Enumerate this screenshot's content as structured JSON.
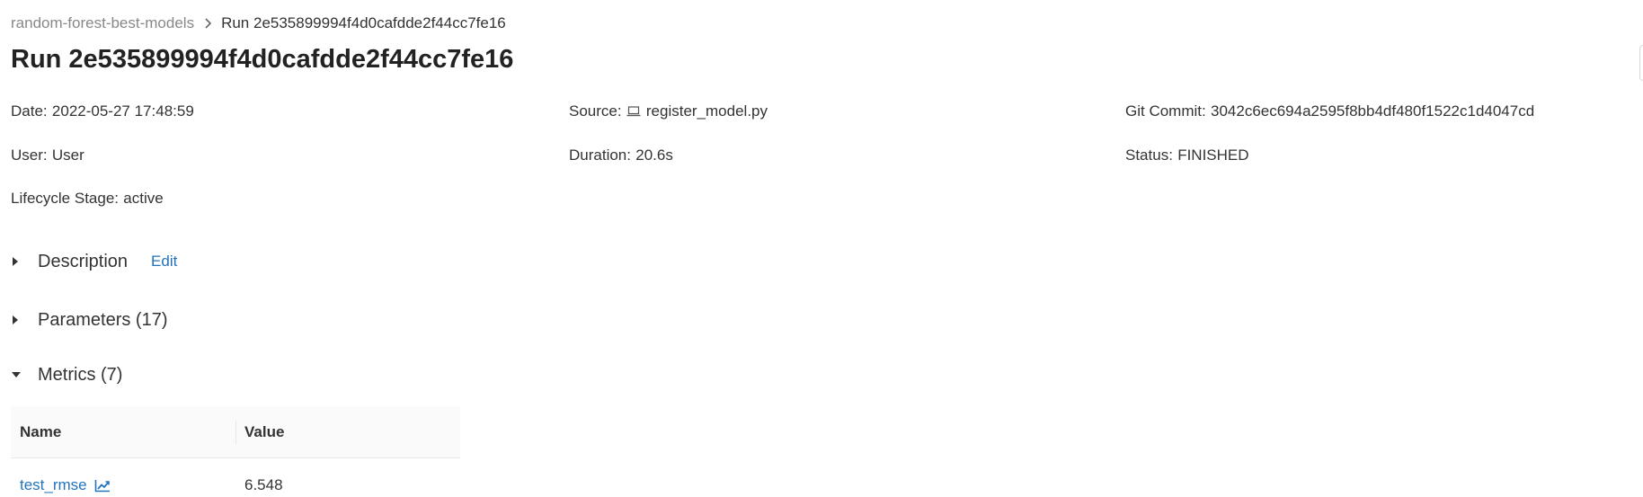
{
  "breadcrumb": {
    "parent": "random-forest-best-models",
    "current": "Run 2e535899994f4d0cafdde2f44cc7fe16"
  },
  "title": "Run 2e535899994f4d0cafdde2f44cc7fe16",
  "meta": {
    "date_label": "Date",
    "date_value": "2022-05-27 17:48:59",
    "source_label": "Source",
    "source_value": "register_model.py",
    "git_label": "Git Commit",
    "git_value": "3042c6ec694a2595f8bb4df480f1522c1d4047cd",
    "user_label": "User",
    "user_value": "User",
    "duration_label": "Duration",
    "duration_value": "20.6s",
    "status_label": "Status",
    "status_value": "FINISHED",
    "lifecycle_label": "Lifecycle Stage",
    "lifecycle_value": "active"
  },
  "sections": {
    "description": "Description",
    "edit": "Edit",
    "parameters": "Parameters (17)",
    "metrics": "Metrics (7)"
  },
  "metrics_table": {
    "headers": [
      "Name",
      "Value"
    ],
    "rows": [
      {
        "name": "test_rmse",
        "value": "6.548"
      }
    ]
  },
  "colors": {
    "link": "#2374bb",
    "text": "#333333",
    "muted": "#888888",
    "header_bg": "#fafafa"
  },
  "icons": [
    "chevron-right-icon",
    "laptop-icon",
    "caret-right-icon",
    "caret-down-icon",
    "line-chart-icon"
  ]
}
